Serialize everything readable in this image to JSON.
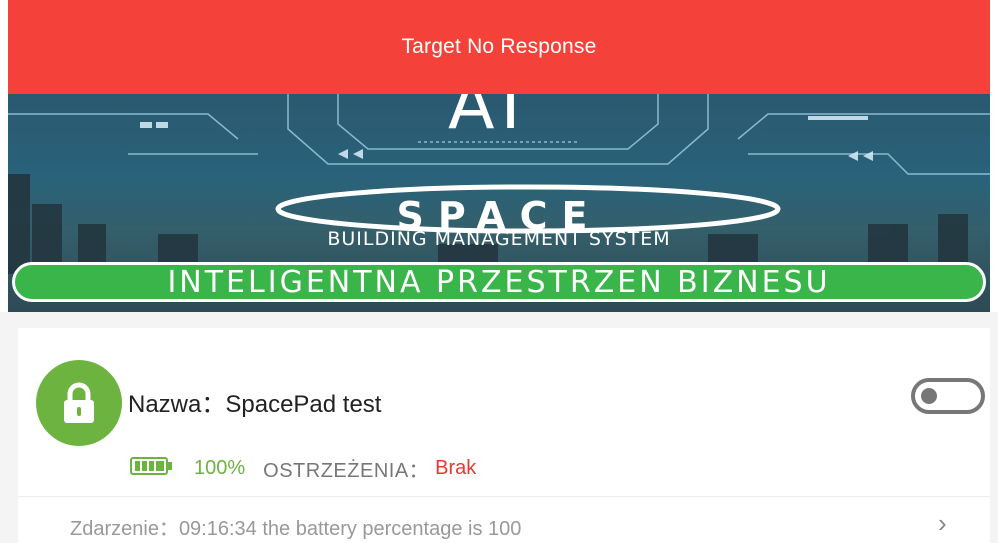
{
  "toast": {
    "message": "Target No Response"
  },
  "banner": {
    "ai_text": "AI",
    "logo_word": "SPACE",
    "subtitle": "BUILDING MANAGEMENT SYSTEM",
    "slogan": "INTELIGENTNA PRZESTRZEN BIZNESU"
  },
  "device": {
    "name_label": "Nazwa：",
    "name_value": "SpacePad test",
    "battery_percent": "100%",
    "warnings_label": "OSTRZEŻENIA：",
    "warnings_value": "Brak",
    "event_label": "Zdarzenie：",
    "event_value": "09:16:34 the battery percentage is 100",
    "toggle_on": false
  },
  "colors": {
    "toast_bg": "#f4413a",
    "accent_green": "#6db33f",
    "warning_red": "#e53935"
  },
  "icons": {
    "lock": "lock-icon",
    "battery": "battery-icon",
    "chevron": "chevron-right-icon"
  }
}
